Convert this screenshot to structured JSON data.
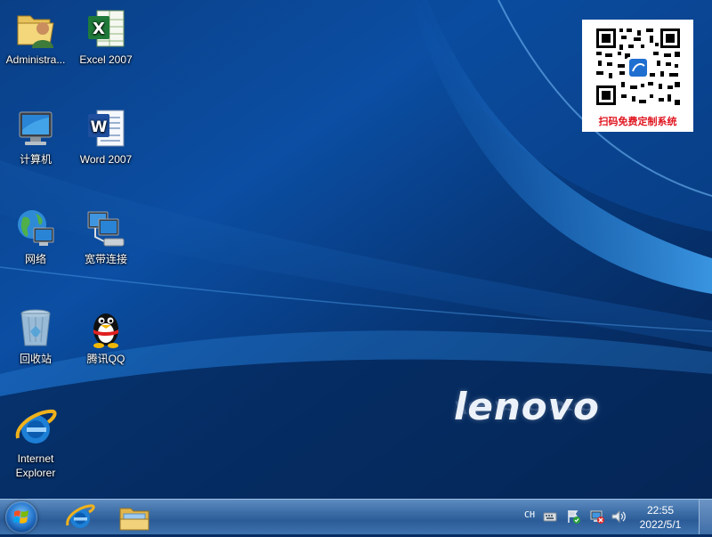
{
  "desktop": {
    "icons": [
      {
        "label": "Administra..."
      },
      {
        "label": "Excel 2007"
      },
      {
        "label": "计算机"
      },
      {
        "label": "Word 2007"
      },
      {
        "label": "网络"
      },
      {
        "label": "宽带连接"
      },
      {
        "label": "回收站"
      },
      {
        "label": "腾讯QQ"
      },
      {
        "label": "Internet\nExplorer"
      }
    ]
  },
  "wallpaper": {
    "brand": "lenovo",
    "qr_caption": "扫码免费定制系统",
    "colors": {
      "deep": "#052453",
      "mid": "#0a4a98",
      "light": "#2d8ae0"
    }
  },
  "taskbar": {
    "pinned": [
      "internet-explorer-icon",
      "windows-explorer-icon"
    ],
    "tray": {
      "language": "CH"
    },
    "clock": {
      "time": "22:55",
      "date": "2022/5/1"
    }
  }
}
